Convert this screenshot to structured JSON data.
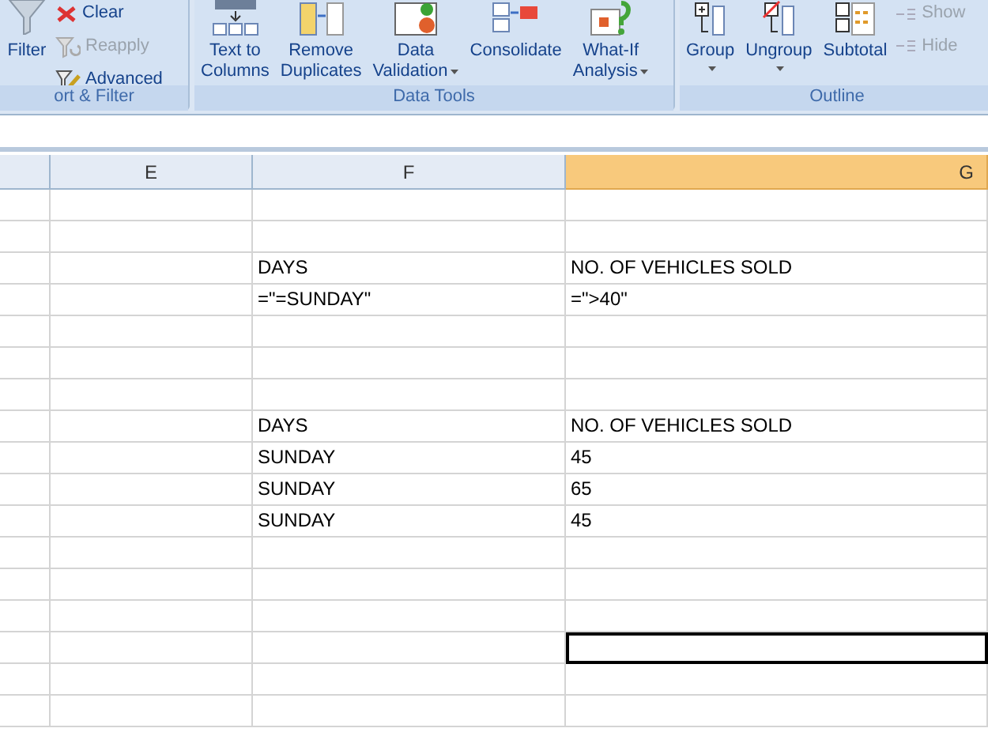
{
  "ribbon": {
    "groups": [
      {
        "label": "ort & Filter",
        "buttons": [
          {
            "label": "Filter",
            "kind": "large",
            "disabled": false,
            "caret": false
          },
          {
            "label": "Clear",
            "kind": "small",
            "disabled": false,
            "caret": false
          },
          {
            "label": "Reapply",
            "kind": "small",
            "disabled": true,
            "caret": false
          },
          {
            "label": "Advanced",
            "kind": "small",
            "disabled": false,
            "caret": false
          }
        ]
      },
      {
        "label": "Data Tools",
        "buttons": [
          {
            "label": "Text to Columns",
            "kind": "large",
            "disabled": false,
            "caret": false
          },
          {
            "label": "Remove Duplicates",
            "kind": "large",
            "disabled": false,
            "caret": false
          },
          {
            "label": "Data Validation",
            "kind": "large",
            "disabled": false,
            "caret": true
          },
          {
            "label": "Consolidate",
            "kind": "large",
            "disabled": false,
            "caret": false
          },
          {
            "label": "What-If Analysis",
            "kind": "large",
            "disabled": false,
            "caret": true
          }
        ]
      },
      {
        "label": "Outline",
        "buttons": [
          {
            "label": "Group",
            "kind": "large",
            "disabled": false,
            "caret": true
          },
          {
            "label": "Ungroup",
            "kind": "large",
            "disabled": false,
            "caret": true
          },
          {
            "label": "Subtotal",
            "kind": "large",
            "disabled": false,
            "caret": false
          },
          {
            "label": "Show",
            "kind": "small",
            "disabled": true,
            "caret": false
          },
          {
            "label": "Hide",
            "kind": "small",
            "disabled": true,
            "caret": false
          }
        ]
      }
    ]
  },
  "columns": [
    {
      "selected": false
    },
    {
      "label": "E",
      "selected": false
    },
    {
      "label": "F",
      "selected": false
    },
    {
      "label": "G",
      "selected": true
    }
  ],
  "rows": [
    {
      "cells": [
        {
          "selected": false
        },
        {
          "selected": false
        },
        {
          "selected": false
        },
        {
          "selected": false
        }
      ]
    },
    {
      "cells": [
        {
          "selected": false
        },
        {
          "selected": false
        },
        {
          "selected": false
        },
        {
          "selected": false
        }
      ]
    },
    {
      "cells": [
        {
          "selected": false
        },
        {
          "selected": false
        },
        {
          "text": "DAYS",
          "selected": false
        },
        {
          "text": "NO. OF VEHICLES SOLD",
          "selected": false
        }
      ]
    },
    {
      "cells": [
        {
          "selected": false
        },
        {
          "selected": false
        },
        {
          "text": "=\"=SUNDAY\"",
          "selected": false
        },
        {
          "text": "=\">40\"",
          "selected": false
        }
      ]
    },
    {
      "cells": [
        {
          "selected": false
        },
        {
          "selected": false
        },
        {
          "selected": false
        },
        {
          "selected": false
        }
      ]
    },
    {
      "cells": [
        {
          "selected": false
        },
        {
          "selected": false
        },
        {
          "selected": false
        },
        {
          "selected": false
        }
      ]
    },
    {
      "cells": [
        {
          "selected": false
        },
        {
          "selected": false
        },
        {
          "selected": false
        },
        {
          "selected": false
        }
      ]
    },
    {
      "cells": [
        {
          "selected": false
        },
        {
          "selected": false
        },
        {
          "text": "DAYS",
          "selected": false
        },
        {
          "text": "NO. OF VEHICLES SOLD",
          "selected": false
        }
      ]
    },
    {
      "cells": [
        {
          "selected": false
        },
        {
          "selected": false
        },
        {
          "text": "SUNDAY",
          "selected": false
        },
        {
          "text": "45",
          "selected": false
        }
      ]
    },
    {
      "cells": [
        {
          "selected": false
        },
        {
          "selected": false
        },
        {
          "text": "SUNDAY",
          "selected": false
        },
        {
          "text": "65",
          "selected": false
        }
      ]
    },
    {
      "cells": [
        {
          "selected": false
        },
        {
          "selected": false
        },
        {
          "text": "SUNDAY",
          "selected": false
        },
        {
          "text": "45",
          "selected": false
        }
      ]
    },
    {
      "cells": [
        {
          "selected": false
        },
        {
          "selected": false
        },
        {
          "selected": false
        },
        {
          "selected": false
        }
      ]
    },
    {
      "cells": [
        {
          "selected": false
        },
        {
          "selected": false
        },
        {
          "selected": false
        },
        {
          "selected": false
        }
      ]
    },
    {
      "cells": [
        {
          "selected": false
        },
        {
          "selected": false
        },
        {
          "selected": false
        },
        {
          "selected": false
        }
      ]
    },
    {
      "cells": [
        {
          "selected": false
        },
        {
          "selected": false
        },
        {
          "selected": false
        },
        {
          "selected": true
        }
      ]
    },
    {
      "cells": [
        {
          "selected": false
        },
        {
          "selected": false
        },
        {
          "selected": false
        },
        {
          "selected": false
        }
      ]
    },
    {
      "cells": [
        {
          "selected": false
        },
        {
          "selected": false
        },
        {
          "selected": false
        },
        {
          "selected": false
        }
      ]
    }
  ]
}
